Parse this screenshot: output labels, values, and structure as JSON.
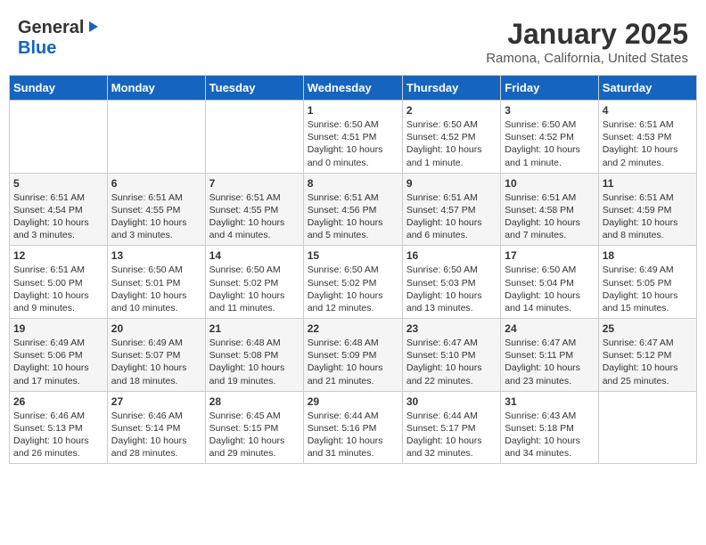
{
  "header": {
    "logo_general": "General",
    "logo_blue": "Blue",
    "month": "January 2025",
    "location": "Ramona, California, United States"
  },
  "weekdays": [
    "Sunday",
    "Monday",
    "Tuesday",
    "Wednesday",
    "Thursday",
    "Friday",
    "Saturday"
  ],
  "weeks": [
    [
      {
        "day": "",
        "content": ""
      },
      {
        "day": "",
        "content": ""
      },
      {
        "day": "",
        "content": ""
      },
      {
        "day": "1",
        "content": "Sunrise: 6:50 AM\nSunset: 4:51 PM\nDaylight: 10 hours\nand 0 minutes."
      },
      {
        "day": "2",
        "content": "Sunrise: 6:50 AM\nSunset: 4:52 PM\nDaylight: 10 hours\nand 1 minute."
      },
      {
        "day": "3",
        "content": "Sunrise: 6:50 AM\nSunset: 4:52 PM\nDaylight: 10 hours\nand 1 minute."
      },
      {
        "day": "4",
        "content": "Sunrise: 6:51 AM\nSunset: 4:53 PM\nDaylight: 10 hours\nand 2 minutes."
      }
    ],
    [
      {
        "day": "5",
        "content": "Sunrise: 6:51 AM\nSunset: 4:54 PM\nDaylight: 10 hours\nand 3 minutes."
      },
      {
        "day": "6",
        "content": "Sunrise: 6:51 AM\nSunset: 4:55 PM\nDaylight: 10 hours\nand 3 minutes."
      },
      {
        "day": "7",
        "content": "Sunrise: 6:51 AM\nSunset: 4:55 PM\nDaylight: 10 hours\nand 4 minutes."
      },
      {
        "day": "8",
        "content": "Sunrise: 6:51 AM\nSunset: 4:56 PM\nDaylight: 10 hours\nand 5 minutes."
      },
      {
        "day": "9",
        "content": "Sunrise: 6:51 AM\nSunset: 4:57 PM\nDaylight: 10 hours\nand 6 minutes."
      },
      {
        "day": "10",
        "content": "Sunrise: 6:51 AM\nSunset: 4:58 PM\nDaylight: 10 hours\nand 7 minutes."
      },
      {
        "day": "11",
        "content": "Sunrise: 6:51 AM\nSunset: 4:59 PM\nDaylight: 10 hours\nand 8 minutes."
      }
    ],
    [
      {
        "day": "12",
        "content": "Sunrise: 6:51 AM\nSunset: 5:00 PM\nDaylight: 10 hours\nand 9 minutes."
      },
      {
        "day": "13",
        "content": "Sunrise: 6:50 AM\nSunset: 5:01 PM\nDaylight: 10 hours\nand 10 minutes."
      },
      {
        "day": "14",
        "content": "Sunrise: 6:50 AM\nSunset: 5:02 PM\nDaylight: 10 hours\nand 11 minutes."
      },
      {
        "day": "15",
        "content": "Sunrise: 6:50 AM\nSunset: 5:02 PM\nDaylight: 10 hours\nand 12 minutes."
      },
      {
        "day": "16",
        "content": "Sunrise: 6:50 AM\nSunset: 5:03 PM\nDaylight: 10 hours\nand 13 minutes."
      },
      {
        "day": "17",
        "content": "Sunrise: 6:50 AM\nSunset: 5:04 PM\nDaylight: 10 hours\nand 14 minutes."
      },
      {
        "day": "18",
        "content": "Sunrise: 6:49 AM\nSunset: 5:05 PM\nDaylight: 10 hours\nand 15 minutes."
      }
    ],
    [
      {
        "day": "19",
        "content": "Sunrise: 6:49 AM\nSunset: 5:06 PM\nDaylight: 10 hours\nand 17 minutes."
      },
      {
        "day": "20",
        "content": "Sunrise: 6:49 AM\nSunset: 5:07 PM\nDaylight: 10 hours\nand 18 minutes."
      },
      {
        "day": "21",
        "content": "Sunrise: 6:48 AM\nSunset: 5:08 PM\nDaylight: 10 hours\nand 19 minutes."
      },
      {
        "day": "22",
        "content": "Sunrise: 6:48 AM\nSunset: 5:09 PM\nDaylight: 10 hours\nand 21 minutes."
      },
      {
        "day": "23",
        "content": "Sunrise: 6:47 AM\nSunset: 5:10 PM\nDaylight: 10 hours\nand 22 minutes."
      },
      {
        "day": "24",
        "content": "Sunrise: 6:47 AM\nSunset: 5:11 PM\nDaylight: 10 hours\nand 23 minutes."
      },
      {
        "day": "25",
        "content": "Sunrise: 6:47 AM\nSunset: 5:12 PM\nDaylight: 10 hours\nand 25 minutes."
      }
    ],
    [
      {
        "day": "26",
        "content": "Sunrise: 6:46 AM\nSunset: 5:13 PM\nDaylight: 10 hours\nand 26 minutes."
      },
      {
        "day": "27",
        "content": "Sunrise: 6:46 AM\nSunset: 5:14 PM\nDaylight: 10 hours\nand 28 minutes."
      },
      {
        "day": "28",
        "content": "Sunrise: 6:45 AM\nSunset: 5:15 PM\nDaylight: 10 hours\nand 29 minutes."
      },
      {
        "day": "29",
        "content": "Sunrise: 6:44 AM\nSunset: 5:16 PM\nDaylight: 10 hours\nand 31 minutes."
      },
      {
        "day": "30",
        "content": "Sunrise: 6:44 AM\nSunset: 5:17 PM\nDaylight: 10 hours\nand 32 minutes."
      },
      {
        "day": "31",
        "content": "Sunrise: 6:43 AM\nSunset: 5:18 PM\nDaylight: 10 hours\nand 34 minutes."
      },
      {
        "day": "",
        "content": ""
      }
    ]
  ]
}
